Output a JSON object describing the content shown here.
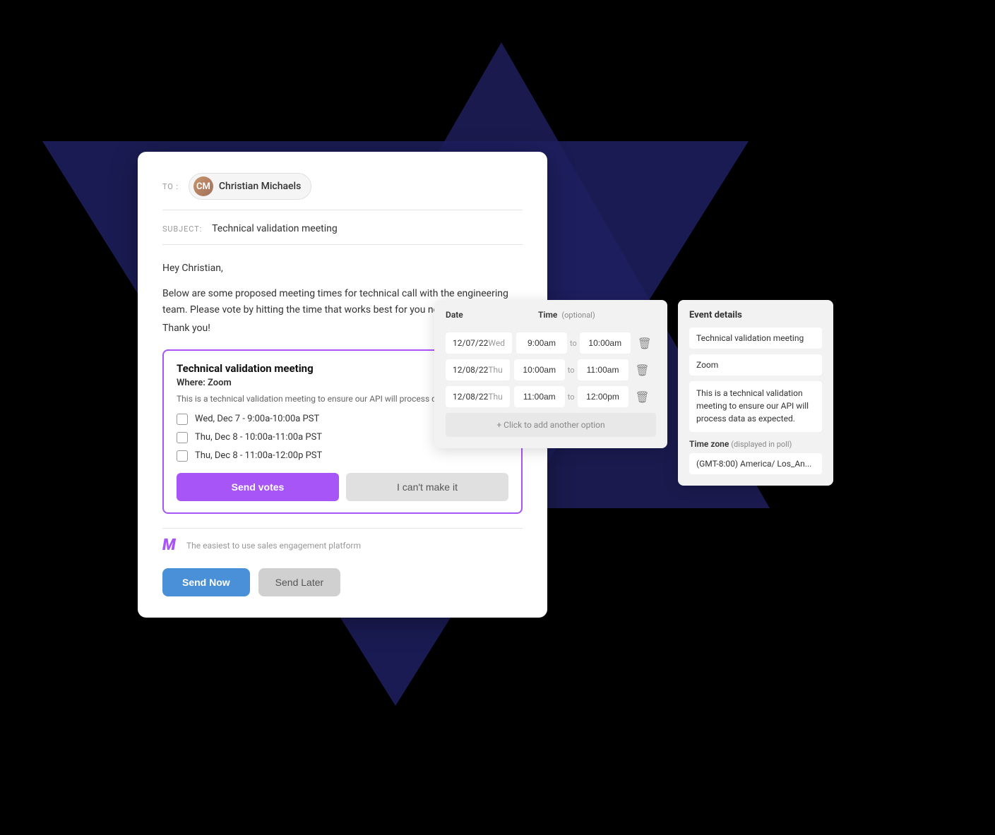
{
  "background": {
    "color": "#000000"
  },
  "email": {
    "to_label": "TO :",
    "recipient_name": "Christian Michaels",
    "subject_label": "SUBJECT:",
    "subject_value": "Technical validation meeting",
    "body_greeting": "Hey Christian,",
    "body_line1": "Below are some proposed meeting times for technical call with the engineering",
    "body_line2": "team.  Please vote by hitting the time that works best for you next to each time.",
    "body_line3": "Thank you!",
    "poll_card": {
      "title": "Technical validation meeting",
      "where_label": "Where:",
      "where_value": "Zoom",
      "description": "This is a technical validation meeting to ensure our API will process data as",
      "options": [
        {
          "label": "Wed, Dec 7 - 9:00a-10:00a PST"
        },
        {
          "label": "Thu, Dec 8 - 10:00a-11:00a PST"
        },
        {
          "label": "Thu, Dec 8 - 11:00a-12:00p PST"
        }
      ],
      "send_votes_label": "Send votes",
      "cant_make_label": "I can't make it"
    },
    "platform_tagline": "The easiest to use sales engagement platform",
    "send_now_label": "Send Now",
    "send_later_label": "Send Later"
  },
  "schedule_panel": {
    "date_label": "Date",
    "time_label": "Time",
    "time_optional": "(optional)",
    "rows": [
      {
        "date": "12/07/22",
        "day": "Wed",
        "start": "9:00am",
        "end": "10:00am"
      },
      {
        "date": "12/08/22",
        "day": "Thu",
        "start": "10:00am",
        "end": "11:00am"
      },
      {
        "date": "12/08/22",
        "day": "Thu",
        "start": "11:00am",
        "end": "12:00pm"
      }
    ],
    "add_option_label": "+ Click to add another option"
  },
  "event_details_panel": {
    "title": "Event details",
    "meeting_name": "Technical validation meeting",
    "location": "Zoom",
    "description": "This is a technical validation meeting to ensure our API will process data as expected.",
    "timezone_label": "Time zone",
    "timezone_note": "(displayed in poll)",
    "timezone_value": "(GMT-8:00) America/ Los_An..."
  }
}
